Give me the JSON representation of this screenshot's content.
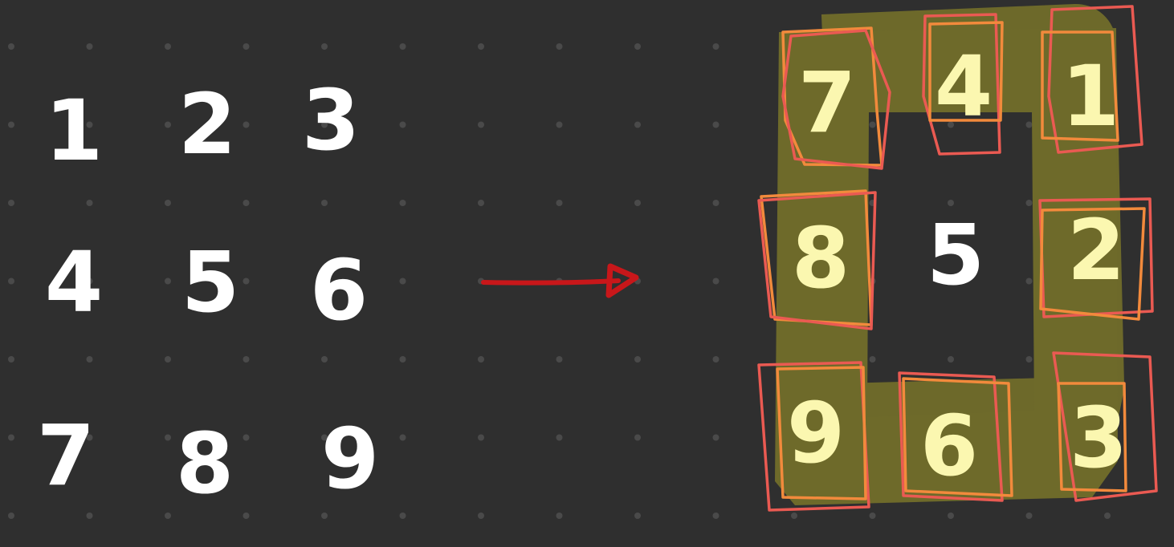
{
  "colors": {
    "background": "#2f2f2f",
    "grid_dot": "#4a4a4a",
    "digit_plain": "#ffffff",
    "digit_ring": "#fbf7b0",
    "ring_highlight": "#6e6a2a",
    "box_orange": "#f28a3c",
    "box_red": "#ea5a52",
    "arrow": "#c8171a"
  },
  "before_grid": [
    [
      "1",
      "2",
      "3"
    ],
    [
      "4",
      "5",
      "6"
    ],
    [
      "7",
      "8",
      "9"
    ]
  ],
  "after_grid": [
    [
      "7",
      "4",
      "1"
    ],
    [
      "8",
      "5",
      "2"
    ],
    [
      "9",
      "6",
      "3"
    ]
  ],
  "arrow_icon": "right-arrow-icon"
}
